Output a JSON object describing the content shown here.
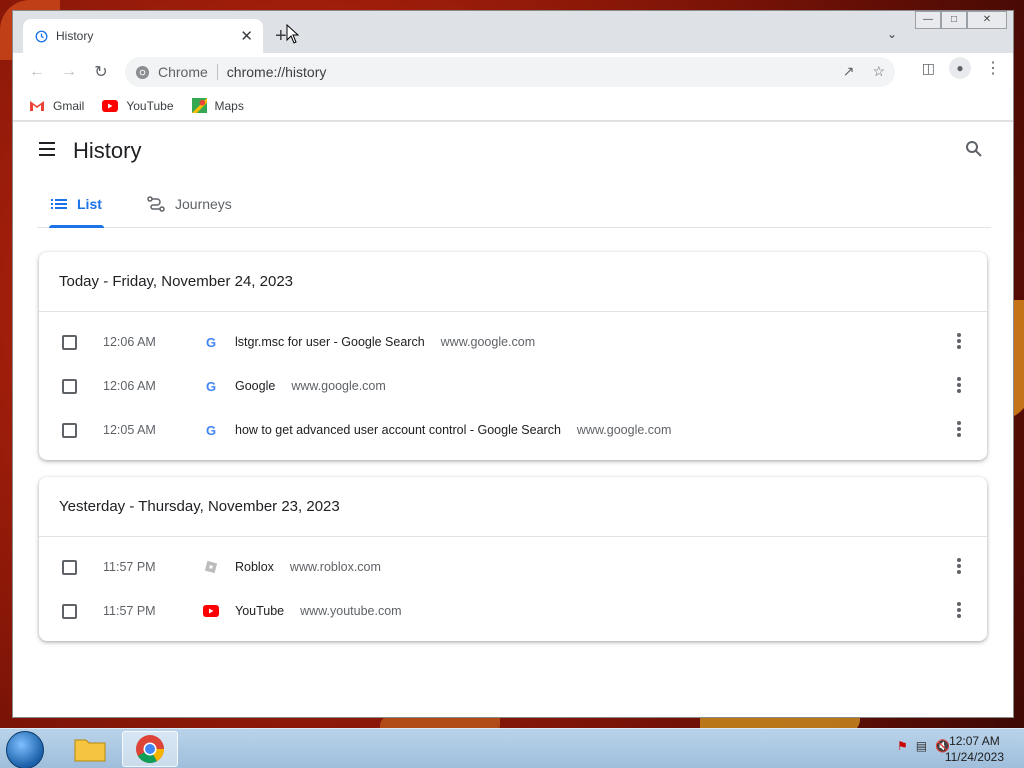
{
  "browser": {
    "tab_title": "History",
    "tab_close": "✕",
    "new_tab": "+",
    "omnibox_chip": "Chrome",
    "omnibox_url": "chrome://history",
    "bookmarks": [
      {
        "label": "Gmail",
        "icon": "gmail-icon",
        "color": "#ea4335"
      },
      {
        "label": "YouTube",
        "icon": "youtube-icon",
        "color": "#ff0000"
      },
      {
        "label": "Maps",
        "icon": "maps-icon",
        "color": "#34a853"
      }
    ]
  },
  "history": {
    "title": "History",
    "tabs": [
      {
        "label": "List",
        "active": true
      },
      {
        "label": "Journeys",
        "active": false
      }
    ],
    "groups": [
      {
        "date": "Today - Friday, November 24, 2023",
        "entries": [
          {
            "time": "12:06 AM",
            "title": "lstgr.msc for user - Google Search",
            "domain": "www.google.com",
            "favicon": "google"
          },
          {
            "time": "12:06 AM",
            "title": "Google",
            "domain": "www.google.com",
            "favicon": "google"
          },
          {
            "time": "12:05 AM",
            "title": "how to get advanced user account control - Google Search",
            "domain": "www.google.com",
            "favicon": "google"
          }
        ]
      },
      {
        "date": "Yesterday - Thursday, November 23, 2023",
        "entries": [
          {
            "time": "11:57 PM",
            "title": "Roblox",
            "domain": "www.roblox.com",
            "favicon": "roblox"
          },
          {
            "time": "11:57 PM",
            "title": "YouTube",
            "domain": "www.youtube.com",
            "favicon": "youtube"
          }
        ]
      }
    ]
  },
  "taskbar": {
    "clock_time": "12:07 AM",
    "clock_date": "11/24/2023"
  },
  "colors": {
    "accent": "#1a73e8",
    "text": "#202124",
    "muted": "#5f6368"
  }
}
